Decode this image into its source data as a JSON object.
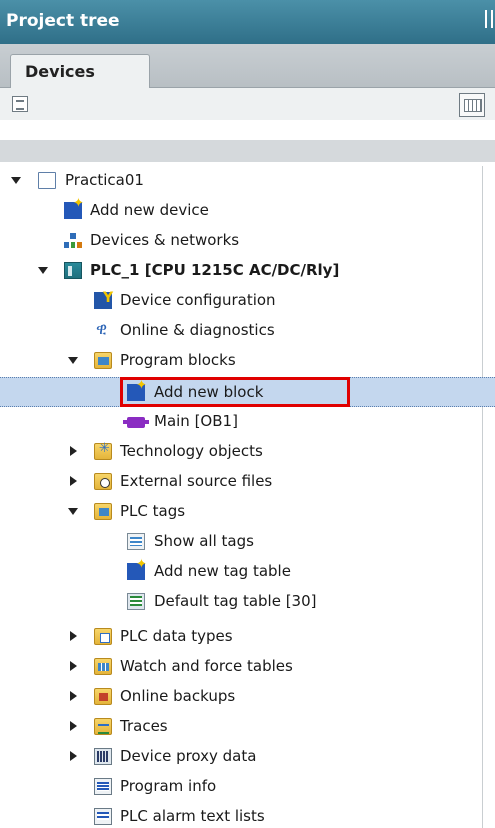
{
  "panel": {
    "title": "Project tree"
  },
  "tabs": [
    {
      "label": "Devices"
    }
  ],
  "tree": {
    "items": [
      {
        "label": "Practica01",
        "icon": "project-page-icon"
      },
      {
        "label": "Add new device",
        "icon": "add-new-device-icon"
      },
      {
        "label": "Devices & networks",
        "icon": "devices-networks-icon"
      },
      {
        "label": "PLC_1 [CPU 1215C AC/DC/Rly]",
        "icon": "plc-icon"
      },
      {
        "label": "Device configuration",
        "icon": "device-configuration-icon"
      },
      {
        "label": "Online & diagnostics",
        "icon": "online-diagnostics-icon"
      },
      {
        "label": "Program blocks",
        "icon": "program-blocks-folder-icon"
      },
      {
        "label": "Add new block",
        "icon": "add-new-block-icon"
      },
      {
        "label": "Main [OB1]",
        "icon": "ob-block-icon"
      },
      {
        "label": "Technology objects",
        "icon": "technology-objects-folder-icon"
      },
      {
        "label": "External source files",
        "icon": "external-source-folder-icon"
      },
      {
        "label": "PLC tags",
        "icon": "plc-tags-folder-icon"
      },
      {
        "label": "Show all tags",
        "icon": "show-all-tags-icon"
      },
      {
        "label": "Add new tag table",
        "icon": "add-tag-table-icon"
      },
      {
        "label": "Default tag table [30]",
        "icon": "tag-table-icon"
      },
      {
        "label": "PLC data types",
        "icon": "plc-data-types-folder-icon"
      },
      {
        "label": "Watch and force tables",
        "icon": "watch-force-folder-icon"
      },
      {
        "label": "Online backups",
        "icon": "online-backups-folder-icon"
      },
      {
        "label": "Traces",
        "icon": "traces-folder-icon"
      },
      {
        "label": "Device proxy data",
        "icon": "device-proxy-icon"
      },
      {
        "label": "Program info",
        "icon": "program-info-icon"
      },
      {
        "label": "PLC alarm text lists",
        "icon": "alarm-text-lists-icon"
      }
    ],
    "selected": "Add new block"
  },
  "colors": {
    "title_bar": "#3b8098",
    "selection": "#c4d7ee",
    "highlight_box": "#e00000"
  }
}
